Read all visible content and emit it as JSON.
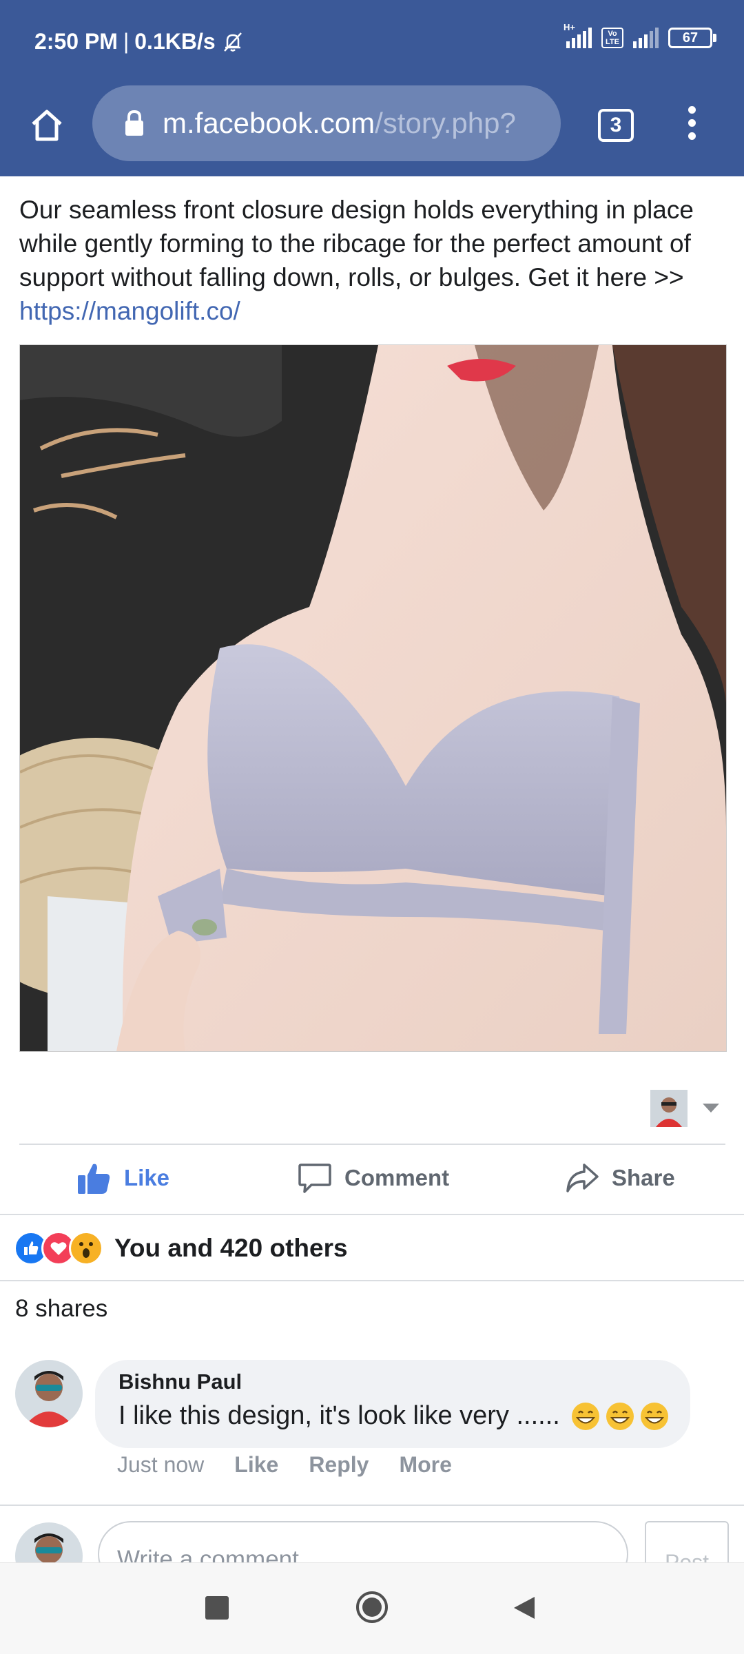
{
  "status_bar": {
    "time": "2:50 PM",
    "separator": "|",
    "speed": "0.1KB/s",
    "network_type": "H+",
    "volte": "Vo LTE",
    "battery": "67"
  },
  "browser": {
    "url_host": "m.facebook.com",
    "url_path": "/story.php?",
    "tab_count": "3",
    "icons": [
      "home-icon",
      "lock-icon",
      "menu-dots-icon"
    ]
  },
  "post": {
    "text": "Our seamless front closure design holds everything in place while gently forming to the ribcage for the perfect amount of support without falling down, rolls, or bulges. Get it here >> ",
    "link": "https://mangolift.co/"
  },
  "actions": {
    "like": "Like",
    "comment": "Comment",
    "share": "Share"
  },
  "reactions": {
    "summary": "You and 420 others",
    "icons": [
      "like-reaction-icon",
      "love-reaction-icon",
      "wow-reaction-icon"
    ]
  },
  "shares_label": "8 shares",
  "comment": {
    "author": "Bishnu Paul",
    "text": "I like this design, it's look like very ......",
    "emoji_count": 3,
    "time": "Just now",
    "like": "Like",
    "reply": "Reply",
    "more": "More"
  },
  "composer": {
    "placeholder": "Write a comment",
    "post_label": "Post"
  },
  "colors": {
    "brand_blue": "#3b5998",
    "like_blue": "#4a7de0",
    "link_blue": "#4267b2"
  }
}
